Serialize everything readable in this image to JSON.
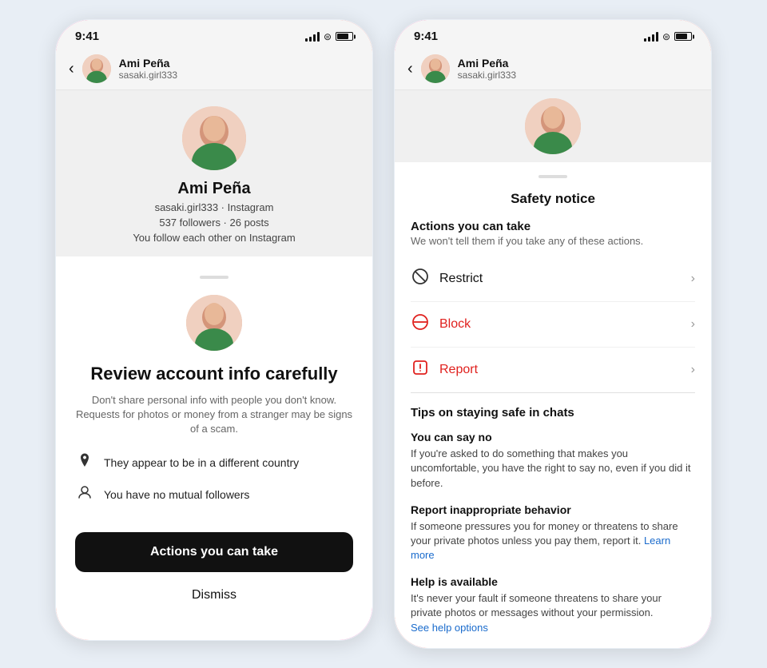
{
  "phone1": {
    "statusBar": {
      "time": "9:41"
    },
    "navHeader": {
      "userName": "Ami Peña",
      "userHandle": "sasaki.girl333"
    },
    "profile": {
      "name": "Ami Peña",
      "handlePlatform": "sasaki.girl333 · Instagram",
      "stats": "537 followers · 26 posts",
      "mutual": "You follow each other on Instagram"
    },
    "sheet": {
      "title": "Review account info carefully",
      "subtitle": "Don't share personal info with people you don't know. Requests for photos or money from a stranger may be signs of a scam.",
      "warnings": [
        {
          "icon": "📍",
          "text": "They appear to be in a different country"
        },
        {
          "icon": "👤",
          "text": "You have no mutual followers"
        }
      ],
      "actionsButton": "Actions you can take",
      "dismissButton": "Dismiss"
    }
  },
  "phone2": {
    "statusBar": {
      "time": "9:41"
    },
    "navHeader": {
      "userName": "Ami Peña",
      "userHandle": "sasaki.girl333"
    },
    "safetySheet": {
      "title": "Safety notice",
      "actionsHeader": "Actions you can take",
      "actionsSub": "We won't tell them if you take any of these actions.",
      "actions": [
        {
          "icon": "🚫",
          "label": "Restrict",
          "color": "normal"
        },
        {
          "icon": "⛔",
          "label": "Block",
          "color": "red"
        },
        {
          "icon": "⚠",
          "label": "Report",
          "color": "red"
        }
      ],
      "tipsHeader": "Tips on staying safe in chats",
      "tips": [
        {
          "title": "You can say no",
          "body": "If you're asked to do something that makes you uncomfortable, you have the right to say no, even if you did it before.",
          "link": null
        },
        {
          "title": "Report inappropriate behavior",
          "body": "If someone pressures you for money or threatens to share your private photos unless you pay them, report it.",
          "linkText": "Learn more",
          "link": "#"
        },
        {
          "title": "Help is available",
          "body": "It's never your fault if someone threatens to share your private photos or messages without your permission.",
          "linkText": "See help options",
          "link": "#"
        }
      ]
    }
  }
}
